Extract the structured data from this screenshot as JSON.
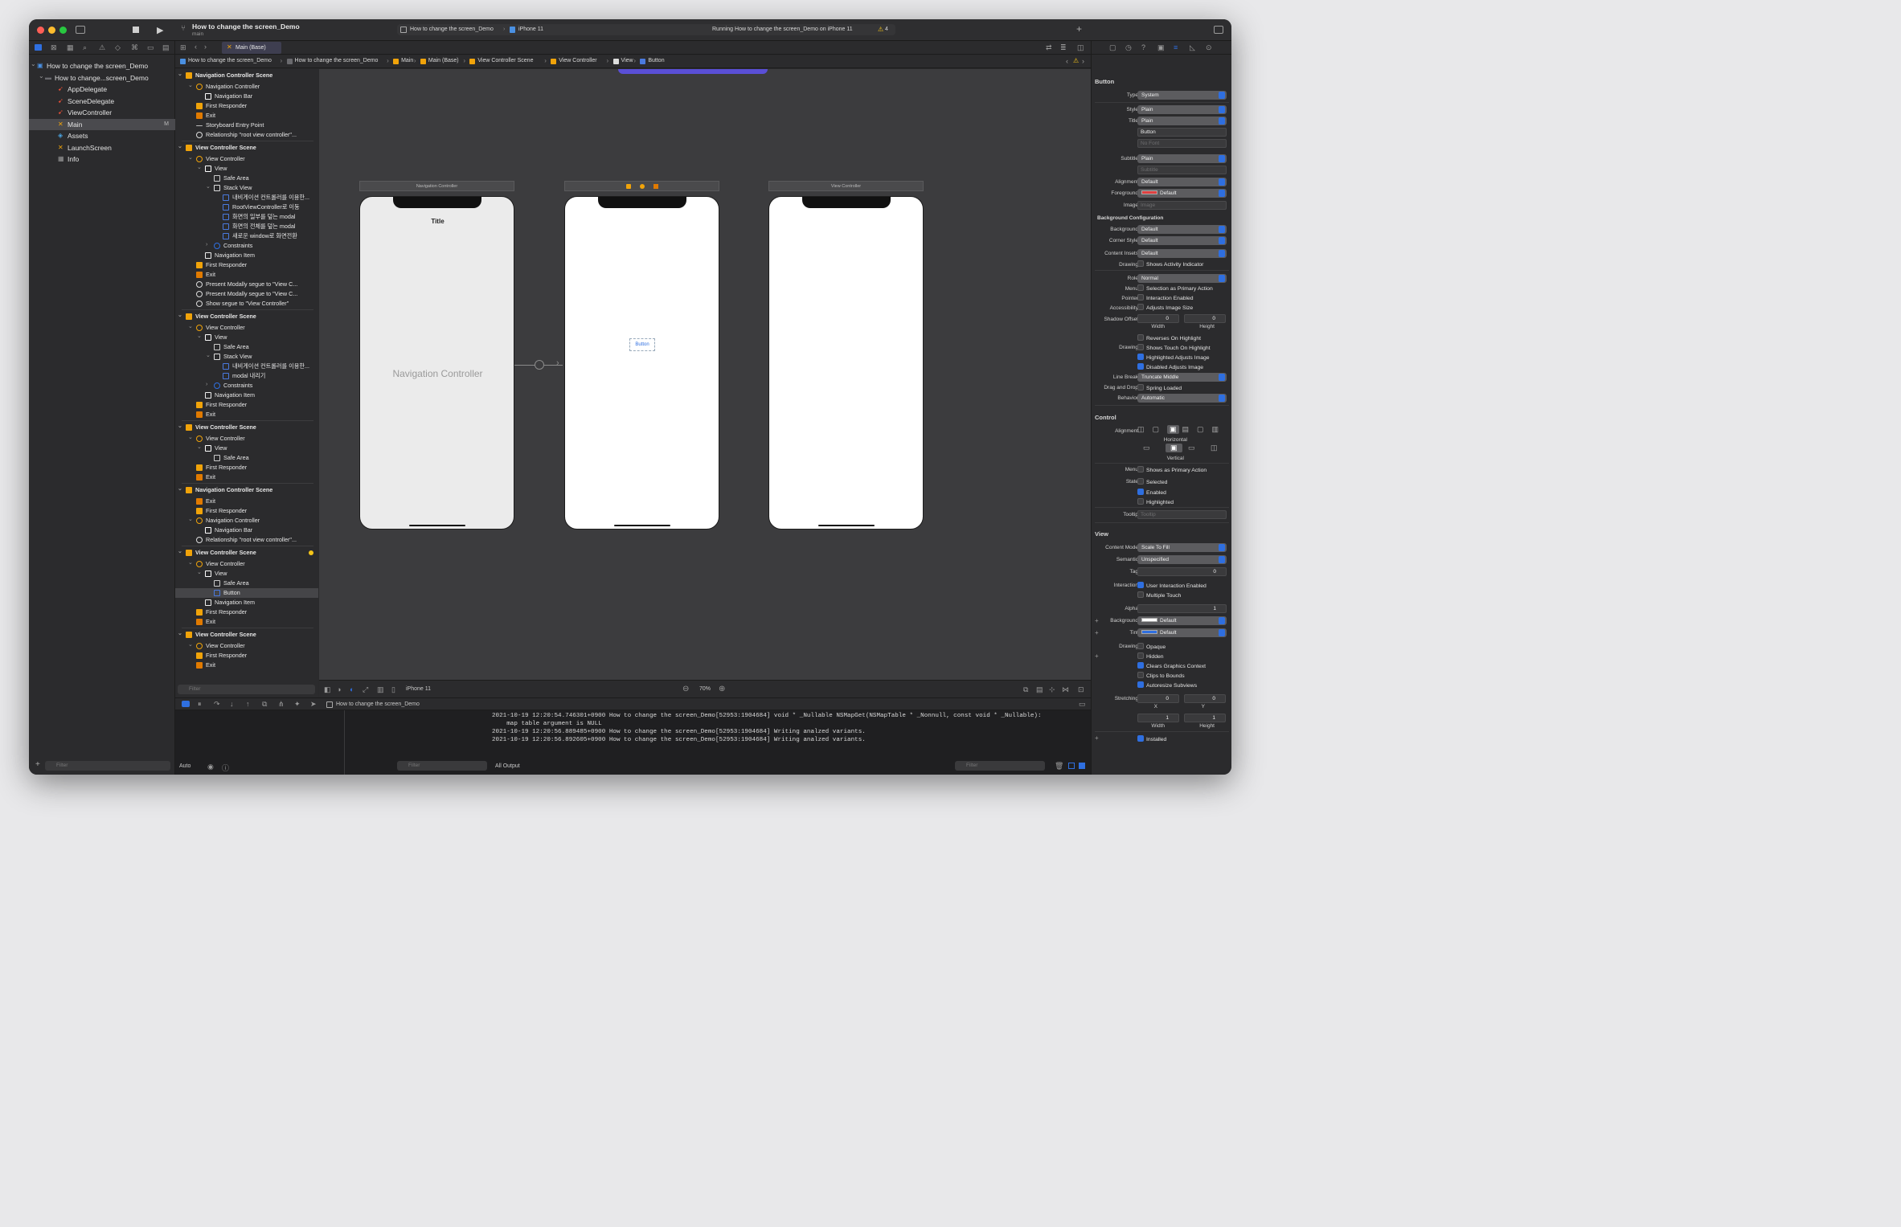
{
  "toolbar": {
    "project_title": "How to change the screen_Demo",
    "branch": "main",
    "scheme_target": "How to change the screen_Demo",
    "device": "iPhone 11",
    "status": "Running How to change the screen_Demo on iPhone 11",
    "warning_count": "4"
  },
  "tab": {
    "label": "Main (Base)"
  },
  "breadcrumb": [
    "How to change the screen_Demo",
    "How to change the screen_Demo",
    "Main",
    "Main (Base)",
    "View Controller Scene",
    "View Controller",
    "View",
    "Button"
  ],
  "navigator": {
    "items": [
      {
        "label": "How to change the screen_Demo",
        "icon": "project-icon"
      },
      {
        "label": "How to change...screen_Demo",
        "icon": "folder-icon"
      },
      {
        "label": "AppDelegate",
        "icon": "swift-file-icon"
      },
      {
        "label": "SceneDelegate",
        "icon": "swift-file-icon"
      },
      {
        "label": "ViewController",
        "icon": "swift-file-icon"
      },
      {
        "label": "Main",
        "icon": "storyboard-icon",
        "badge": "M"
      },
      {
        "label": "Assets",
        "icon": "assets-icon"
      },
      {
        "label": "LaunchScreen",
        "icon": "storyboard-icon"
      },
      {
        "label": "Info",
        "icon": "plist-icon"
      }
    ],
    "filter_placeholder": "Filter"
  },
  "outline": {
    "rows": [
      {
        "label": "Navigation Controller Scene",
        "level": 0,
        "type": "scene"
      },
      {
        "label": "Navigation Controller",
        "level": 1,
        "type": "controller"
      },
      {
        "label": "Navigation Bar",
        "level": 2,
        "type": "bar"
      },
      {
        "label": "First Responder",
        "level": 1,
        "type": "responder"
      },
      {
        "label": "Exit",
        "level": 1,
        "type": "exit"
      },
      {
        "label": "Storyboard Entry Point",
        "level": 1,
        "type": "arrow"
      },
      {
        "label": "Relationship \"root view controller\"...",
        "level": 1,
        "type": "segue"
      },
      {
        "label": "View Controller Scene",
        "level": 0,
        "type": "scene"
      },
      {
        "label": "View Controller",
        "level": 1,
        "type": "controller"
      },
      {
        "label": "View",
        "level": 2,
        "type": "view"
      },
      {
        "label": "Safe Area",
        "level": 3,
        "type": "safe"
      },
      {
        "label": "Stack View",
        "level": 3,
        "type": "stack"
      },
      {
        "label": "내비게이션 컨트롤러를 이용한...",
        "level": 4,
        "type": "button"
      },
      {
        "label": "RootViewController로 이동",
        "level": 4,
        "type": "button"
      },
      {
        "label": "화면의 일부를 덮는 modal",
        "level": 4,
        "type": "button"
      },
      {
        "label": "화면의 전체를 덮는 modal",
        "level": 4,
        "type": "button"
      },
      {
        "label": "새로운 window로 화면전환",
        "level": 4,
        "type": "button"
      },
      {
        "label": "Constraints",
        "level": 3,
        "type": "constraints"
      },
      {
        "label": "Navigation Item",
        "level": 2,
        "type": "navitem"
      },
      {
        "label": "First Responder",
        "level": 1,
        "type": "responder"
      },
      {
        "label": "Exit",
        "level": 1,
        "type": "exit"
      },
      {
        "label": "Present Modally segue to \"View C...",
        "level": 1,
        "type": "segue"
      },
      {
        "label": "Present Modally segue to \"View C...",
        "level": 1,
        "type": "segue"
      },
      {
        "label": "Show segue to \"View Controller\"",
        "level": 1,
        "type": "segue"
      },
      {
        "label": "View Controller Scene",
        "level": 0,
        "type": "scene"
      },
      {
        "label": "View Controller",
        "level": 1,
        "type": "controller"
      },
      {
        "label": "View",
        "level": 2,
        "type": "view"
      },
      {
        "label": "Safe Area",
        "level": 3,
        "type": "safe"
      },
      {
        "label": "Stack View",
        "level": 3,
        "type": "stack"
      },
      {
        "label": "내비게이션 컨트롤러를 이용한...",
        "level": 4,
        "type": "button"
      },
      {
        "label": "modal 내리기",
        "level": 4,
        "type": "button"
      },
      {
        "label": "Constraints",
        "level": 3,
        "type": "constraints"
      },
      {
        "label": "Navigation Item",
        "level": 2,
        "type": "navitem"
      },
      {
        "label": "First Responder",
        "level": 1,
        "type": "responder"
      },
      {
        "label": "Exit",
        "level": 1,
        "type": "exit"
      },
      {
        "label": "View Controller Scene",
        "level": 0,
        "type": "scene"
      },
      {
        "label": "View Controller",
        "level": 1,
        "type": "controller"
      },
      {
        "label": "View",
        "level": 2,
        "type": "view"
      },
      {
        "label": "Safe Area",
        "level": 3,
        "type": "safe"
      },
      {
        "label": "First Responder",
        "level": 1,
        "type": "responder"
      },
      {
        "label": "Exit",
        "level": 1,
        "type": "exit"
      },
      {
        "label": "Navigation Controller Scene",
        "level": 0,
        "type": "scene"
      },
      {
        "label": "Exit",
        "level": 1,
        "type": "exit"
      },
      {
        "label": "First Responder",
        "level": 1,
        "type": "responder"
      },
      {
        "label": "Navigation Controller",
        "level": 1,
        "type": "controller"
      },
      {
        "label": "Navigation Bar",
        "level": 2,
        "type": "bar"
      },
      {
        "label": "Relationship \"root view controller\"...",
        "level": 1,
        "type": "segue"
      },
      {
        "label": "View Controller Scene",
        "level": 0,
        "type": "scene"
      },
      {
        "label": "View Controller",
        "level": 1,
        "type": "controller"
      },
      {
        "label": "View",
        "level": 2,
        "type": "view"
      },
      {
        "label": "Safe Area",
        "level": 3,
        "type": "safe"
      },
      {
        "label": "Button",
        "level": 3,
        "type": "button",
        "selected": true
      },
      {
        "label": "Navigation Item",
        "level": 2,
        "type": "navitem"
      },
      {
        "label": "First Responder",
        "level": 1,
        "type": "responder"
      },
      {
        "label": "Exit",
        "level": 1,
        "type": "exit"
      },
      {
        "label": "View Controller Scene",
        "level": 0,
        "type": "scene"
      },
      {
        "label": "View Controller",
        "level": 1,
        "type": "controller"
      },
      {
        "label": "First Responder",
        "level": 1,
        "type": "responder"
      },
      {
        "label": "Exit",
        "level": 1,
        "type": "exit"
      }
    ],
    "filter_placeholder": "Filter"
  },
  "canvas": {
    "scene1_title": "Navigation Controller",
    "scene1_nav_title": "Title",
    "scene1_label": "Navigation Controller",
    "scene3_title": "View Controller",
    "button_label": "Button",
    "device": "iPhone 11",
    "zoom": "70%"
  },
  "inspector": {
    "header": "Button",
    "type": "System",
    "style": "Plain",
    "title_mode": "Plain",
    "title_text": "Button",
    "font_placeholder": "No Font",
    "subtitle_mode": "Plain",
    "subtitle_placeholder": "Subtitle",
    "alignment": "Default",
    "foreground": "Default",
    "image_placeholder": "Image",
    "bg_config_header": "Background Configuration",
    "background": "Default",
    "corner_style": "Default",
    "content_insets": "Default",
    "shows_activity": "Shows Activity Indicator",
    "role": "Normal",
    "selection_primary": "Selection as Primary Action",
    "interaction_enabled": "Interaction Enabled",
    "adjusts_image_size": "Adjusts Image Size",
    "shadow_w": "0",
    "shadow_h": "0",
    "reverses": "Reverses On Highlight",
    "shows_touch": "Shows Touch On Highlight",
    "highlighted_adjusts": "Highlighted Adjusts Image",
    "disabled_adjusts": "Disabled Adjusts Image",
    "line_break": "Truncate Middle",
    "spring_loaded": "Spring Loaded",
    "behavior": "Automatic",
    "control_header": "Control",
    "horizontal": "Horizontal",
    "vertical": "Vertical",
    "shows_primary": "Shows as Primary Action",
    "state_selected": "Selected",
    "state_enabled": "Enabled",
    "state_highlighted": "Highlighted",
    "tooltip_placeholder": "Tooltip",
    "view_header": "View",
    "content_mode": "Scale To Fill",
    "semantic": "Unspecified",
    "tag": "0",
    "user_interaction": "User Interaction Enabled",
    "multiple_touch": "Multiple Touch",
    "alpha": "1",
    "view_background": "Default",
    "tint": "Default",
    "opaque": "Opaque",
    "hidden": "Hidden",
    "clears_context": "Clears Graphics Context",
    "clips": "Clips to Bounds",
    "autoresize": "Autoresize Subviews",
    "stretch_x": "0",
    "stretch_y": "0",
    "stretch_w": "1",
    "stretch_h": "1",
    "installed": "Installed",
    "labels": {
      "type": "Type",
      "style": "Style",
      "title": "Title",
      "subtitle": "Subtitle",
      "alignment": "Alignment",
      "foreground": "Foreground",
      "image": "Image",
      "background": "Background",
      "corner_style": "Corner Style",
      "content_insets": "Content Insets",
      "drawing": "Drawing",
      "role": "Role",
      "menu": "Menu",
      "pointer": "Pointer",
      "accessibility": "Accessibility",
      "shadow_offset": "Shadow Offset",
      "width": "Width",
      "height": "Height",
      "line_break": "Line Break",
      "drag_drop": "Drag and Drop",
      "behavior": "Behavior",
      "state": "State",
      "tooltip": "Tooltip",
      "content_mode": "Content Mode",
      "semantic": "Semantic",
      "tag": "Tag",
      "interaction": "Interaction",
      "alpha": "Alpha",
      "tint": "Tint",
      "stretching": "Stretching",
      "x": "X",
      "y": "Y"
    }
  },
  "console": {
    "scheme": "How to change the screen_Demo",
    "log_lines": [
      "2021-10-19 12:20:54.746301+0900 How to change the screen_Demo[52953:1904684] void * _Nullable NSMapGet(NSMapTable * _Nonnull, const void * _Nullable):",
      "    map table argument is NULL",
      "2021-10-19 12:20:56.889485+0900 How to change the screen_Demo[52953:1904684] Writing analzed variants.",
      "2021-10-19 12:20:56.892605+0900 How to change the screen_Demo[52953:1904684] Writing analzed variants."
    ],
    "auto_label": "Auto",
    "output_label": "All Output",
    "filter_placeholder": "Filter"
  },
  "colors": {
    "accent": "#2f6fe0",
    "storyboard": "#f0a30a",
    "swift": "#f05138",
    "scene_bg": "#ebebeb"
  }
}
